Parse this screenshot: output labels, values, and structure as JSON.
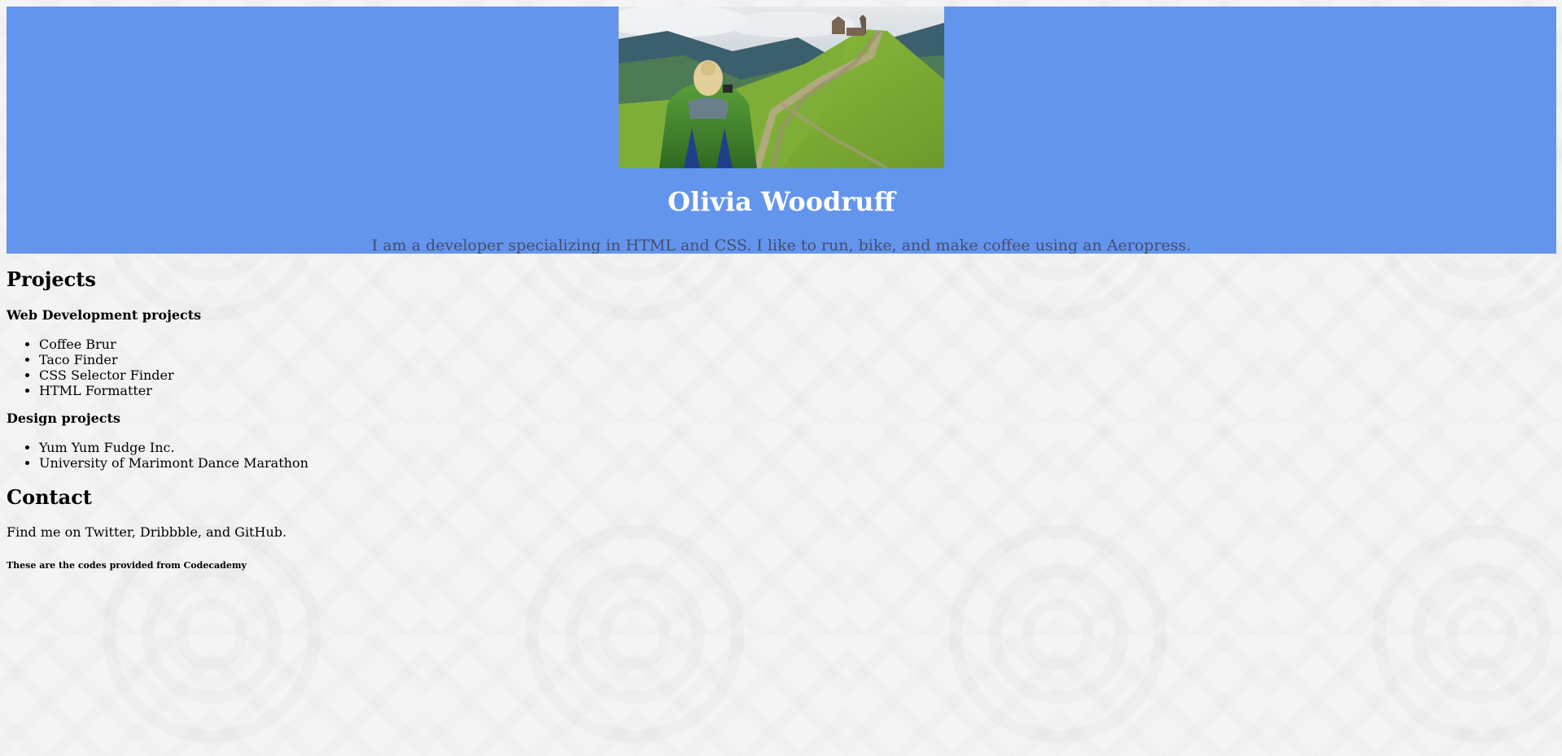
{
  "header": {
    "name": "Olivia Woodruff",
    "intro": "I am a developer specializing in HTML and CSS. I like to run, bike, and make coffee using an Aeropress."
  },
  "projects": {
    "title": "Projects",
    "web": {
      "title": "Web Development projects",
      "items": [
        "Coffee Brur",
        "Taco Finder",
        "CSS Selector Finder",
        "HTML Formatter"
      ]
    },
    "design": {
      "title": "Design projects",
      "items": [
        "Yum Yum Fudge Inc.",
        "University of Marimont Dance Marathon"
      ]
    }
  },
  "contact": {
    "title": "Contact",
    "text": "Find me on Twitter, Dribbble, and GitHub.",
    "note": "These are the codes provided from Codecademy"
  },
  "colors": {
    "header_bg": "#6495ed",
    "name_text": "#ffffff",
    "intro_text": "#404e72",
    "page_bg": "#f4f4f4"
  }
}
